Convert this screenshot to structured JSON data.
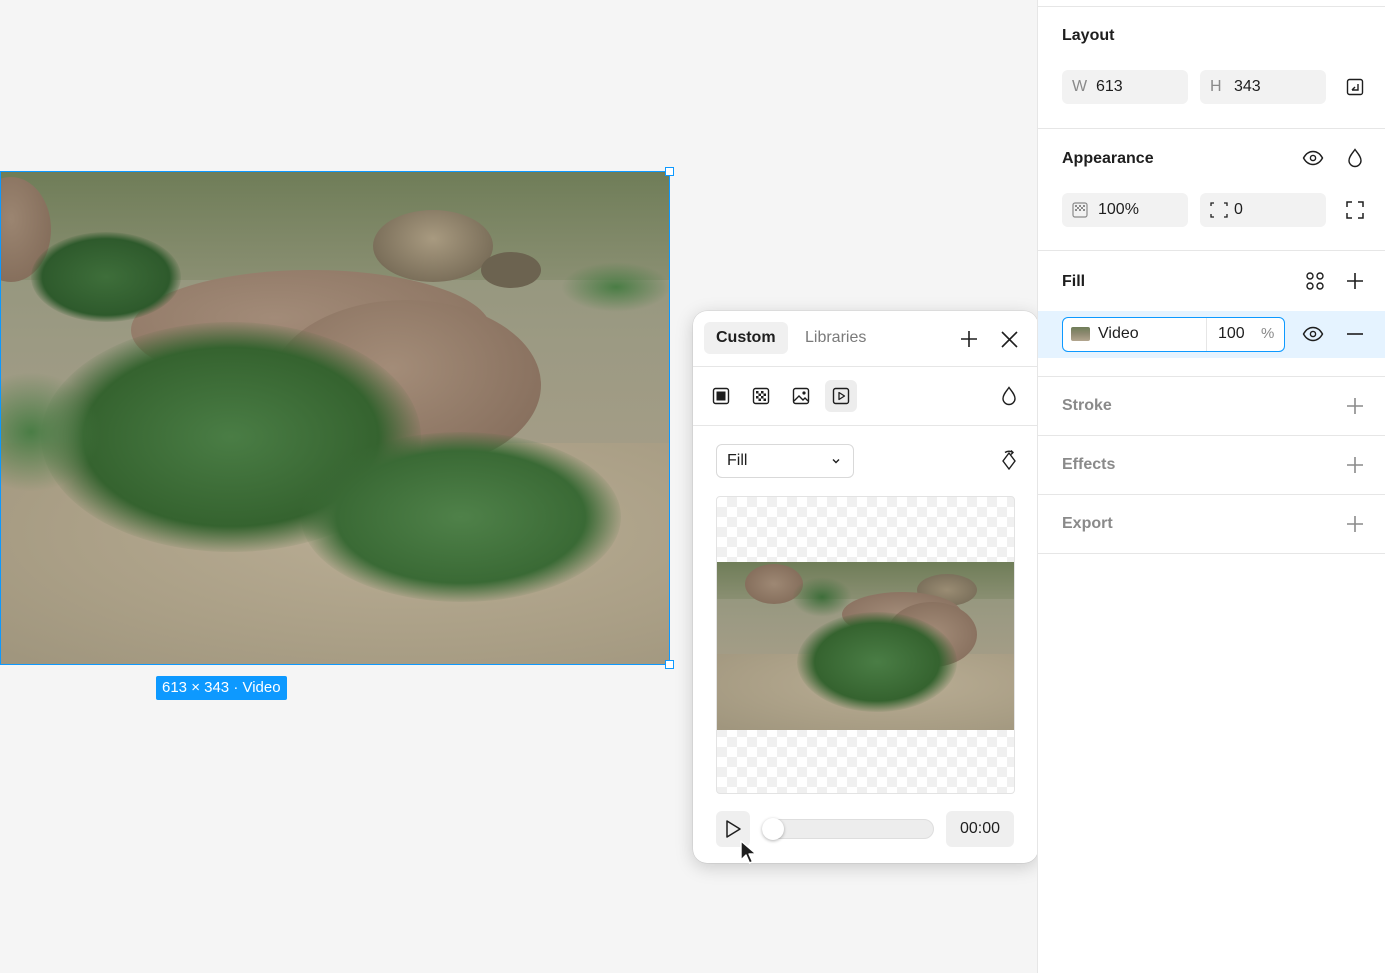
{
  "canvas": {
    "selection_label": "613 × 343 · Video"
  },
  "fill_picker": {
    "tabs": [
      {
        "label": "Custom",
        "active": true
      },
      {
        "label": "Libraries",
        "active": false
      }
    ],
    "paint_types": [
      "solid-fill-icon",
      "pattern-fill-icon",
      "image-fill-icon",
      "video-fill-icon"
    ],
    "selected_paint_type": "video-fill-icon",
    "fill_mode": "Fill",
    "playback": {
      "time": "00:00",
      "progress": 0
    }
  },
  "properties": {
    "layout": {
      "title": "Layout",
      "width_label": "W",
      "width_value": "613",
      "height_label": "H",
      "height_value": "343"
    },
    "appearance": {
      "title": "Appearance",
      "opacity": "100%",
      "corner_radius": "0"
    },
    "fill": {
      "title": "Fill",
      "layer": {
        "name": "Video",
        "opacity": "100",
        "unit": "%"
      }
    },
    "stroke": {
      "title": "Stroke"
    },
    "effects": {
      "title": "Effects"
    },
    "export": {
      "title": "Export"
    }
  },
  "colors": {
    "selection": "#0d99ff",
    "fill_row_highlight": "#e5f3ff"
  }
}
